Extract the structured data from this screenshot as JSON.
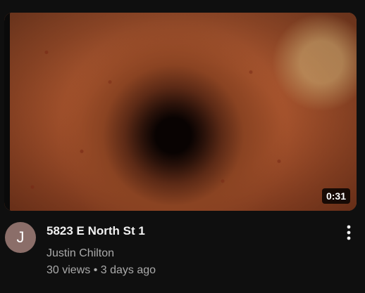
{
  "video": {
    "duration": "0:31",
    "title": "5823 E North St 1",
    "channel": "Justin Chilton",
    "avatar_letter": "J",
    "views": "30 views",
    "separator": "•",
    "age": "3 days ago"
  },
  "icons": {
    "menu": "more-vert-icon"
  },
  "colors": {
    "background": "#0f0f0f",
    "title": "#f1f1f1",
    "secondary_text": "#aaaaaa",
    "avatar": "#8b6e69"
  }
}
